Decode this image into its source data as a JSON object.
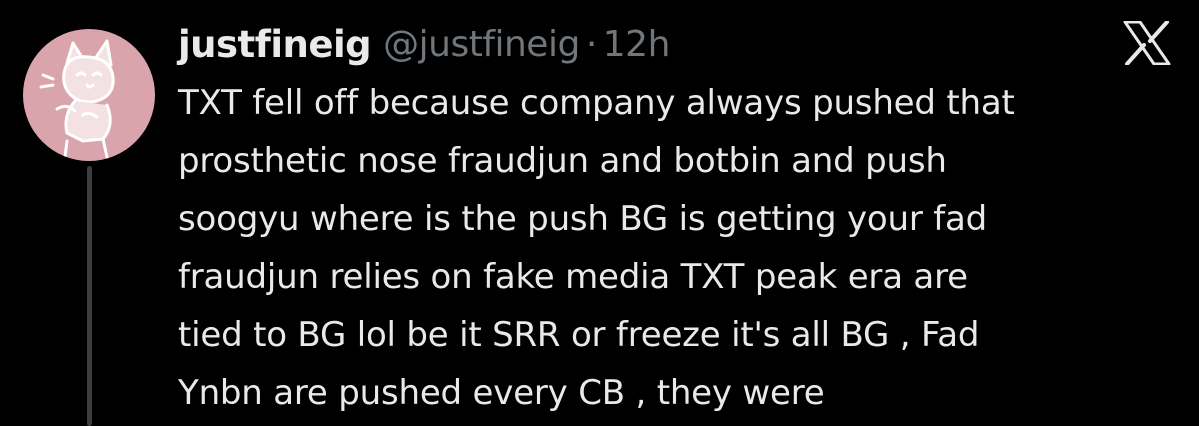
{
  "tweet": {
    "display_name": "justfineig",
    "handle": "@justfineig",
    "separator": "·",
    "time": "12h",
    "lines": [
      "TXT fell off because company always pushed that",
      "prosthetic nose fraudjun and botbin and push",
      "soogyu where is the push BG is getting your fad",
      "fraudjun relies on fake media TXT peak era are",
      "tied to BG lol be it SRR or freeze it's all BG , Fad",
      "Ynbn are pushed every CB , they were"
    ]
  },
  "icons": {
    "avatar": "cartoon-cat-avatar",
    "platform_logo": "x-logo-icon"
  },
  "colors": {
    "background": "#000000",
    "primary_text": "#e7e9ea",
    "secondary_text": "#71767b",
    "avatar_bg": "#d9a4ab",
    "thread_line": "#3a3d41"
  }
}
